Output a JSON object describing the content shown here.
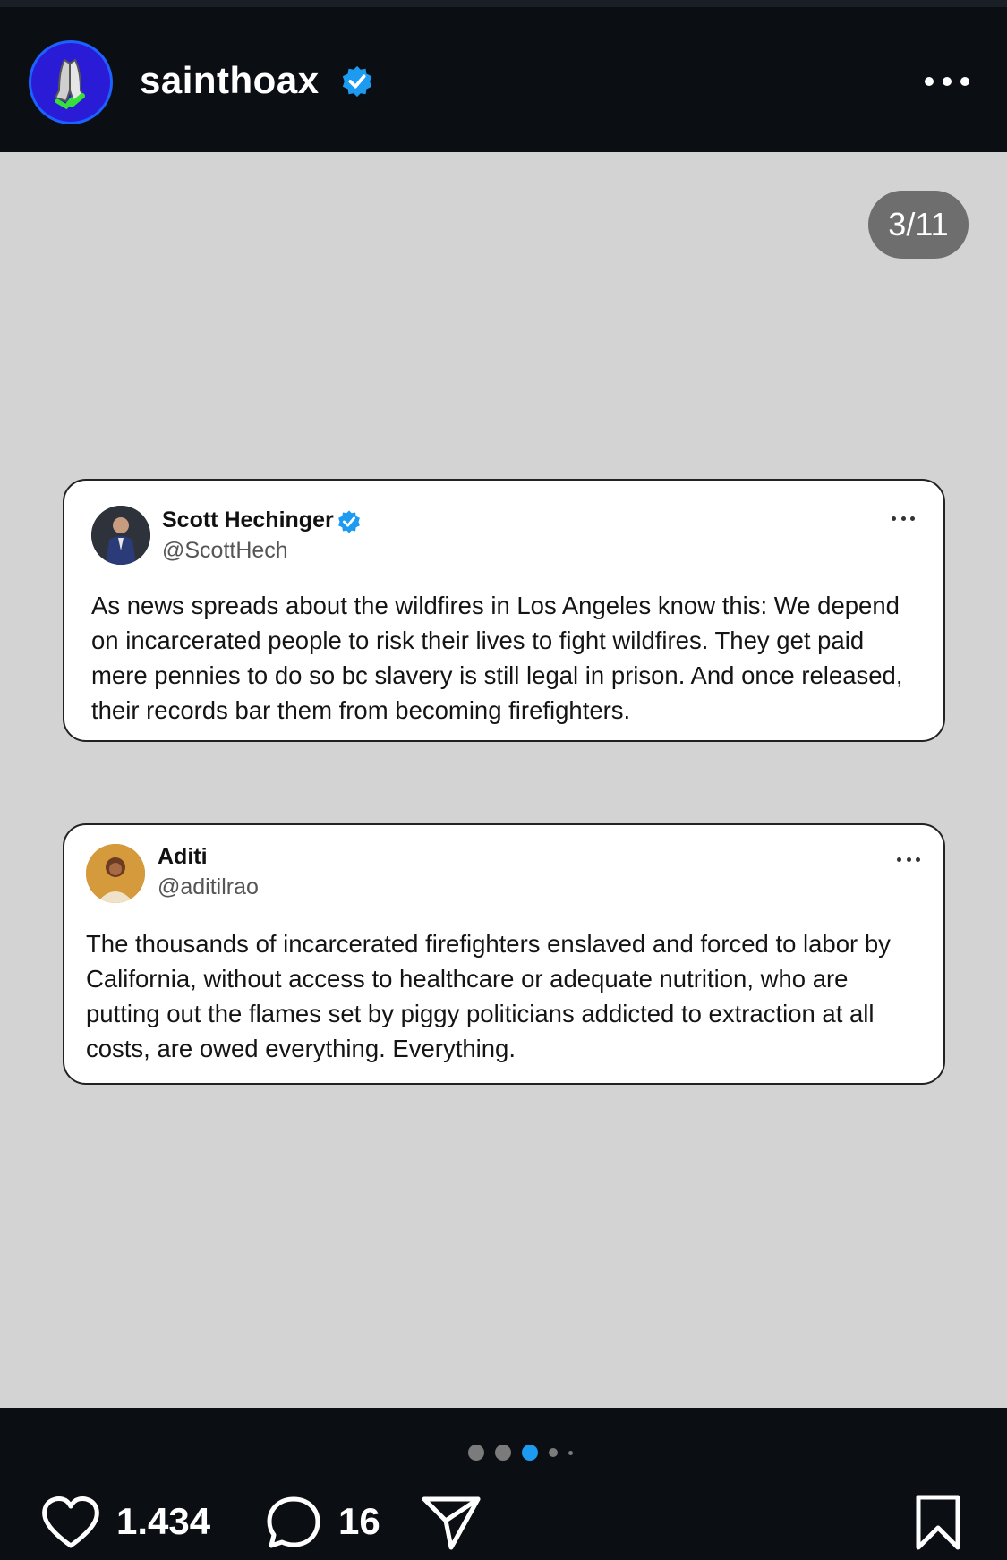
{
  "header": {
    "username": "sainthoax",
    "avatar_icon": "praying-hands-icon",
    "verified_icon": "verified-badge-icon",
    "more_icon": "more-options-icon"
  },
  "carousel": {
    "counter": "3/11",
    "active_index": 3,
    "dot_count": 5
  },
  "tweets": [
    {
      "name": "Scott Hechinger",
      "handle": "@ScottHech",
      "verified": true,
      "text": "As news spreads about the wildfires in Los Angeles know this: We depend on incarcerated people to risk their lives to fight wildfires. They get paid mere pennies to do so bc slavery is still legal in prison. And once released, their records bar them from becoming firefighters."
    },
    {
      "name": "Aditi",
      "handle": "@aditilrao",
      "verified": false,
      "text": "The thousands of incarcerated firefighters enslaved and forced to labor by California, without access to healthcare or adequate nutrition, who are putting out the flames set by piggy politicians addicted to extraction at all costs, are owed everything. Everything."
    }
  ],
  "actions": {
    "likes": "1.434",
    "comments": "16"
  },
  "colors": {
    "accent": "#1d9bf0",
    "background_dark": "#0b0f14",
    "content_bg": "#d3d3d3",
    "avatar_bg": "#2a1bd6"
  }
}
